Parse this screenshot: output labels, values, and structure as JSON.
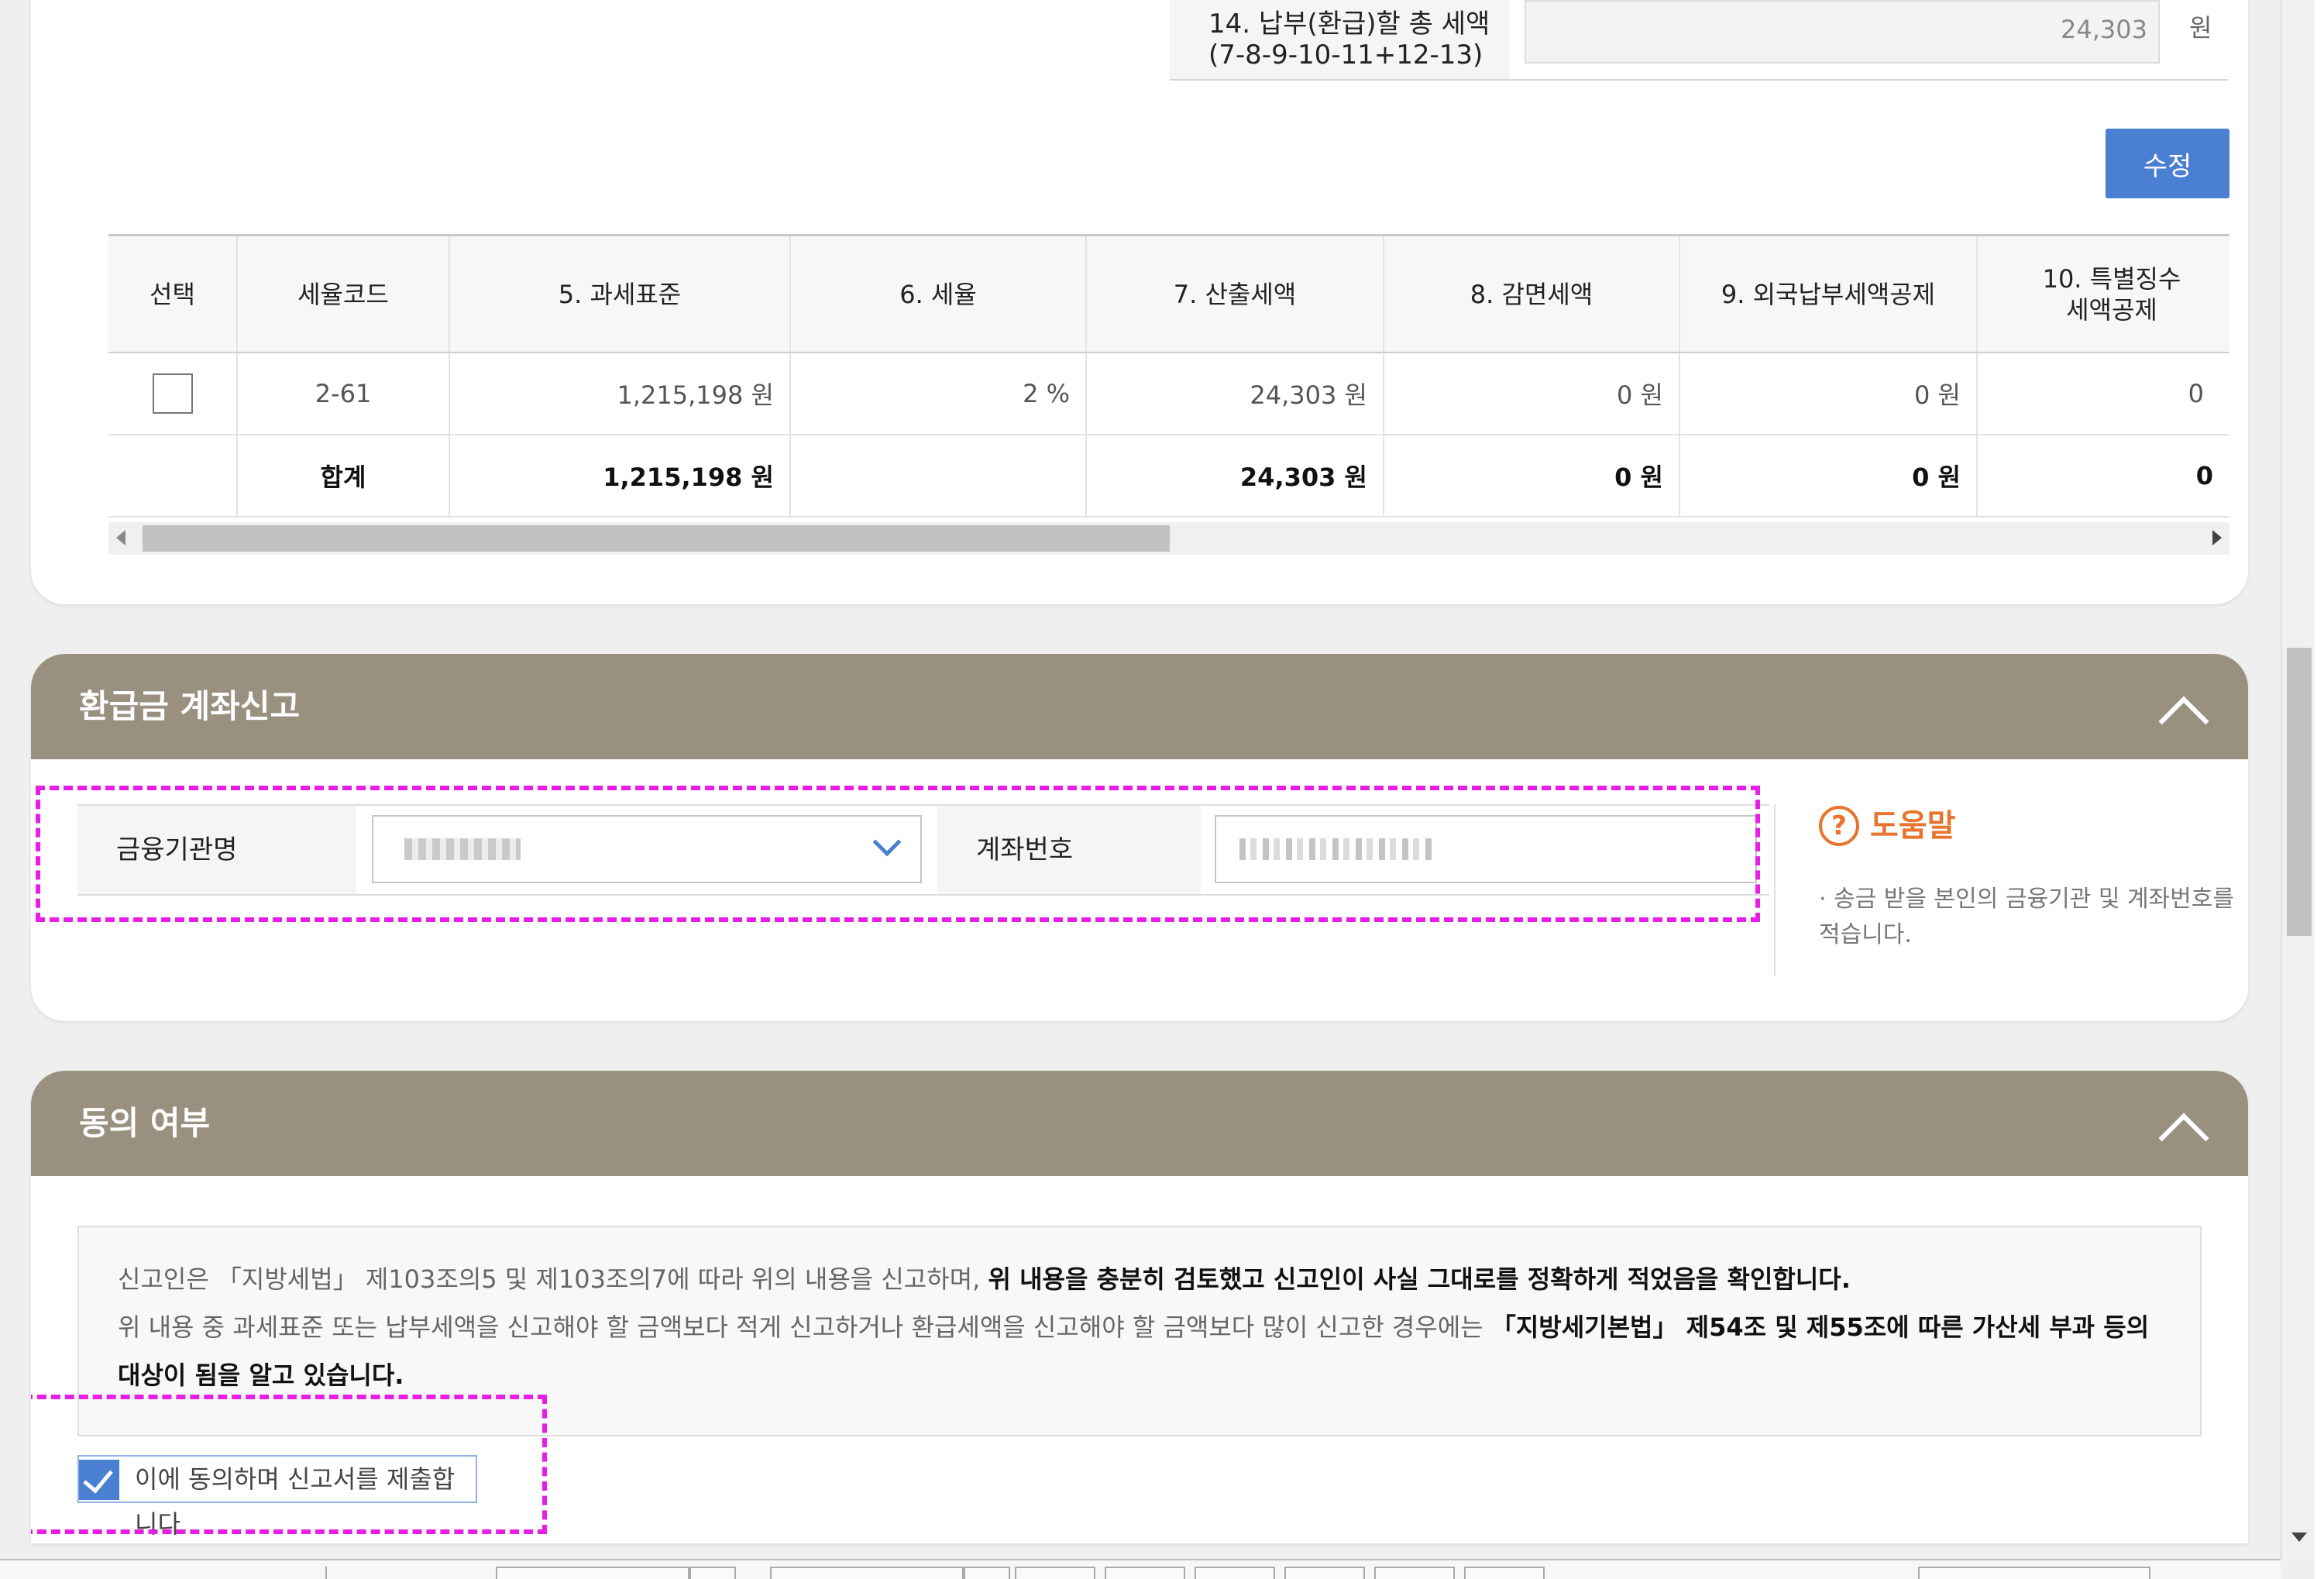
{
  "summary": {
    "label_line1": "14. 납부(환급)할 총 세액",
    "label_line2": "(7-8-9-10-11+12-13)",
    "value": "24,303",
    "unit": "원"
  },
  "edit_button": "수정",
  "tax_table": {
    "headers": [
      "선택",
      "세율코드",
      "5. 과세표준",
      "6. 세율",
      "7. 산출세액",
      "8. 감면세액",
      "9. 외국납부세액공제",
      "10. 특별징수",
      "세액공제"
    ],
    "row": {
      "selected": false,
      "code": "2-61",
      "base": "1,215,198 원",
      "rate": "2 %",
      "calc": "24,303 원",
      "reduction": "0 원",
      "foreign": "0 원",
      "special": "0"
    },
    "total": {
      "label": "합계",
      "base": "1,215,198 원",
      "calc": "24,303 원",
      "reduction": "0 원",
      "foreign": "0 원",
      "special": "0"
    }
  },
  "refund_section": {
    "title": "환급금 계좌신고",
    "bank_label": "금융기관명",
    "account_label": "계좌번호",
    "help_icon": "?",
    "help_title": "도움말",
    "help_text": "· 송금 받을 본인의 금융기관 및 계좌번호를 적습니다."
  },
  "consent_section": {
    "title": "동의 여부",
    "line1_normal": "신고인은 「지방세법」 제103조의5 및 제103조의7에 따라 위의 내용을 신고하며, ",
    "line1_bold": "위 내용을 충분히 검토했고 신고인이 사실 그대로를 정확하게 적었음을 확인합니다.",
    "line2_normal": "위 내용 중 과세표준 또는 납부세액을 신고해야 할 금액보다 적게 신고하거나 환급세액을 신고해야 할 금액보다 많이 신고한 경우에는 ",
    "line2_bold": "「지방세기본법」 제54조 및 제55조에 따른 가산세 부과 등의 대상이 됨을 알고 있습니다.",
    "agree_checked": true,
    "agree_label": "이에 동의하며 신고서를 제출합니다."
  },
  "colors": {
    "accent": "#4a7fd1",
    "section_header": "#9a907f",
    "help": "#e8742e",
    "highlight": "#e81ee6"
  }
}
